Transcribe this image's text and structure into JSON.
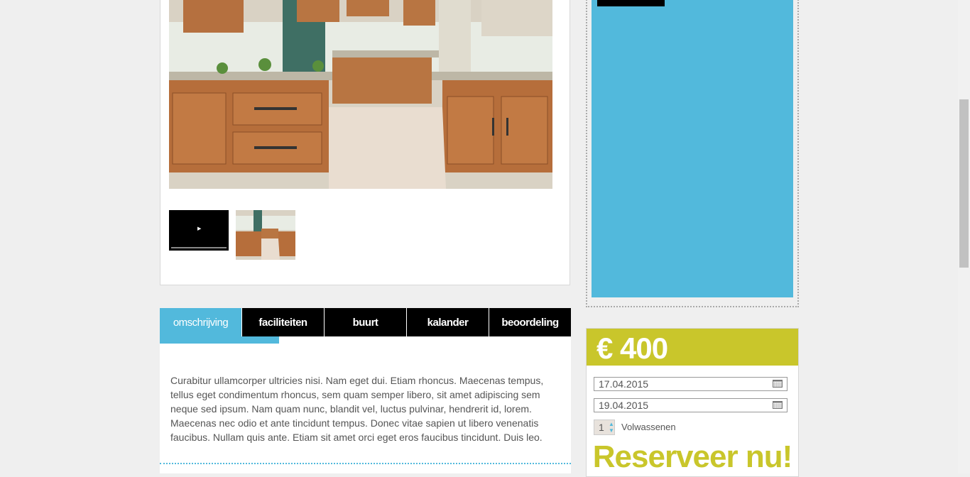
{
  "gallery": {
    "main_image": "kitchen-photo",
    "thumbnails": [
      "video-thumbnail",
      "kitchen-photo-thumbnail"
    ]
  },
  "tabs": [
    {
      "label": "omschrijving",
      "active": true
    },
    {
      "label": "faciliteiten",
      "active": false
    },
    {
      "label": "buurt",
      "active": false
    },
    {
      "label": "kalander",
      "active": false
    },
    {
      "label": "beoordeling",
      "active": false
    }
  ],
  "description": "Curabitur ullamcorper ultricies nisi. Nam eget dui. Etiam rhoncus. Maecenas tempus, tellus eget condimentum rhoncus, sem quam semper libero, sit amet adipiscing sem neque sed ipsum. Nam quam nunc, blandit vel, luctus pulvinar, hendrerit id, lorem. Maecenas nec odio et ante tincidunt tempus. Donec vitae sapien ut libero venenatis faucibus. Nullam quis ante. Etiam sit amet orci eget eros faucibus tincidunt. Duis leo.",
  "booking": {
    "price": "€ 400",
    "date_from": "17.04.2015",
    "date_to": "19.04.2015",
    "adults_value": "1",
    "adults_label": "Volwassenen",
    "reserve_label": "Reserveer nu!"
  },
  "colors": {
    "accent_blue": "#52b9dc",
    "accent_olive": "#c9c62b",
    "tab_black": "#000000"
  }
}
